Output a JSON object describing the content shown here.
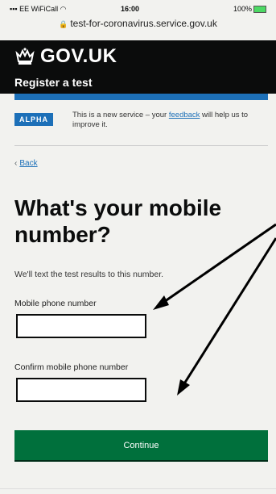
{
  "status_bar": {
    "carrier": "EE WiFiCall",
    "time": "16:00",
    "battery": "100%"
  },
  "browser": {
    "url": "test-for-coronavirus.service.gov.uk"
  },
  "header": {
    "logo_text": "GOV.UK",
    "service_name": "Register a test"
  },
  "phase_banner": {
    "tag": "ALPHA",
    "text_before_link": "This is a new service – your ",
    "link_text": "feedback",
    "text_after_link": " will help us to improve it."
  },
  "back_link": {
    "label": "Back"
  },
  "main": {
    "heading": "What's your mobile number?",
    "hint": "We'll text the test results to this number.",
    "field1_label": "Mobile phone number",
    "field1_value": "",
    "field2_label": "Confirm mobile phone number",
    "field2_value": "",
    "continue_label": "Continue"
  },
  "colors": {
    "header_bg": "#0b0c0c",
    "blue_bar": "#1d70b8",
    "button_green": "#00703c"
  },
  "icons": {
    "crown": "crown-icon",
    "lock": "lock-icon",
    "back": "chevron-left-icon"
  }
}
